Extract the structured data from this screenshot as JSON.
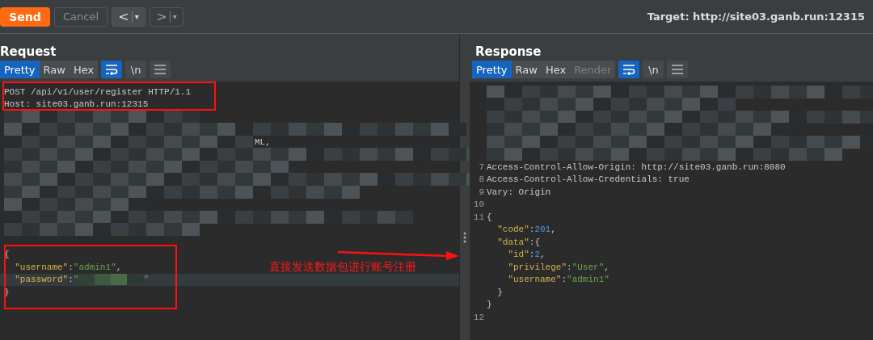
{
  "toolbar": {
    "send": "Send",
    "cancel": "Cancel",
    "cancel_disabled": true,
    "back": {
      "label": "<",
      "caret": "▾"
    },
    "forward": {
      "label": ">",
      "caret": "▾"
    },
    "target": "Target: http://site03.ganb.run:12315"
  },
  "request": {
    "title": "Request",
    "tabs": [
      {
        "label": "Pretty",
        "selected": true,
        "disabled": false
      },
      {
        "label": "Raw",
        "selected": false,
        "disabled": false
      },
      {
        "label": "Hex",
        "selected": false,
        "disabled": false
      }
    ],
    "wrap_on": true,
    "newline_label": "\\n",
    "lines": [
      {
        "kind": "code",
        "tokens": [
          {
            "kind": "plain",
            "text": "POST /api/v1/user/register HTTP/1.1"
          }
        ]
      },
      {
        "kind": "code",
        "tokens": [
          {
            "kind": "plain",
            "text": "Host: site03.ganb.run:12315"
          }
        ]
      },
      {
        "kind": "redacted"
      },
      {
        "kind": "redacted"
      },
      {
        "kind": "redacted",
        "tail": "ML,"
      },
      {
        "kind": "redacted"
      },
      {
        "kind": "redacted"
      },
      {
        "kind": "redacted"
      },
      {
        "kind": "redacted"
      },
      {
        "kind": "redacted"
      },
      {
        "kind": "redacted"
      },
      {
        "kind": "redacted"
      },
      {
        "kind": "code"
      },
      {
        "kind": "code",
        "tokens": [
          {
            "kind": "plain",
            "text": "{"
          }
        ]
      },
      {
        "kind": "code",
        "tokens": [
          {
            "kind": "key",
            "text": "  \"username\""
          },
          {
            "kind": "plain",
            "text": ":"
          },
          {
            "kind": "string",
            "text": "\"admin1\""
          },
          {
            "kind": "plain",
            "text": ","
          }
        ]
      },
      {
        "kind": "code",
        "current": true,
        "tokens": [
          {
            "kind": "key",
            "text": "  \"password\""
          },
          {
            "kind": "plain",
            "text": ":"
          },
          {
            "kind": "string",
            "text": "\""
          },
          {
            "kind": "redacted"
          },
          {
            "kind": "string",
            "text": "\""
          }
        ]
      },
      {
        "kind": "code",
        "tokens": [
          {
            "kind": "plain",
            "text": "}"
          }
        ]
      }
    ]
  },
  "annotation": {
    "text": "直接发送数据包进行账号注册"
  },
  "response": {
    "title": "Response",
    "tabs": [
      {
        "label": "Pretty",
        "selected": true,
        "disabled": false
      },
      {
        "label": "Raw",
        "selected": false,
        "disabled": false
      },
      {
        "label": "Hex",
        "selected": false,
        "disabled": false
      },
      {
        "label": "Render",
        "selected": false,
        "disabled": true
      }
    ],
    "wrap_on": true,
    "newline_label": "\\n",
    "lines": [
      {
        "kind": "redacted"
      },
      {
        "kind": "redacted"
      },
      {
        "kind": "redacted"
      },
      {
        "kind": "redacted"
      },
      {
        "kind": "redacted"
      },
      {
        "kind": "redacted"
      },
      {
        "kind": "code",
        "number": "7",
        "tokens": [
          {
            "kind": "plain",
            "text": "Access-Control-Allow-Origin: http://site03.ganb.run:8080"
          }
        ]
      },
      {
        "kind": "code",
        "number": "8",
        "tokens": [
          {
            "kind": "plain",
            "text": "Access-Control-Allow-Credentials: true"
          }
        ]
      },
      {
        "kind": "code",
        "number": "9",
        "tokens": [
          {
            "kind": "plain",
            "text": "Vary: Origin"
          }
        ]
      },
      {
        "kind": "code",
        "number": "10"
      },
      {
        "kind": "code",
        "number": "11",
        "tokens": [
          {
            "kind": "plain",
            "text": "{"
          }
        ]
      },
      {
        "kind": "code",
        "tokens": [
          {
            "kind": "key",
            "text": "  \"code\""
          },
          {
            "kind": "plain",
            "text": ":"
          },
          {
            "kind": "number",
            "text": "201"
          },
          {
            "kind": "plain",
            "text": ","
          }
        ]
      },
      {
        "kind": "code",
        "tokens": [
          {
            "kind": "key",
            "text": "  \"data\""
          },
          {
            "kind": "plain",
            "text": ":{"
          }
        ]
      },
      {
        "kind": "code",
        "tokens": [
          {
            "kind": "key",
            "text": "    \"id\""
          },
          {
            "kind": "plain",
            "text": ":"
          },
          {
            "kind": "number",
            "text": "2"
          },
          {
            "kind": "plain",
            "text": ","
          }
        ]
      },
      {
        "kind": "code",
        "tokens": [
          {
            "kind": "key",
            "text": "    \"privilege\""
          },
          {
            "kind": "plain",
            "text": ":"
          },
          {
            "kind": "string",
            "text": "\"User\""
          },
          {
            "kind": "plain",
            "text": ","
          }
        ]
      },
      {
        "kind": "code",
        "tokens": [
          {
            "kind": "key",
            "text": "    \"username\""
          },
          {
            "kind": "plain",
            "text": ":"
          },
          {
            "kind": "string",
            "text": "\"admin1\""
          }
        ]
      },
      {
        "kind": "code",
        "tokens": [
          {
            "kind": "plain",
            "text": "  }"
          }
        ]
      },
      {
        "kind": "code",
        "tokens": [
          {
            "kind": "plain",
            "text": "}"
          }
        ]
      },
      {
        "kind": "code",
        "number": "12"
      }
    ]
  }
}
